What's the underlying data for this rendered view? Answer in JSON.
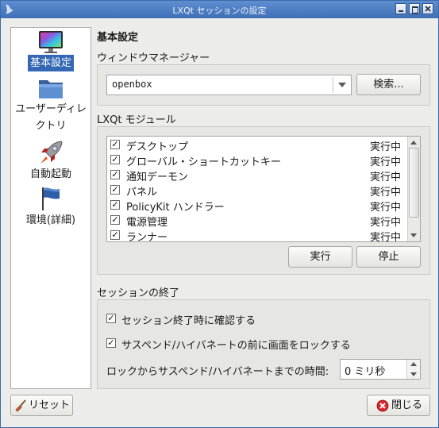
{
  "window": {
    "title": "LXQt セッションの設定"
  },
  "sidebar": {
    "items": [
      {
        "label": "基本設定",
        "icon": "monitor-icon",
        "selected": true
      },
      {
        "label": "ユーザーディレクトリ",
        "label_line1": "ユーザーディレ",
        "label_line2": "クトリ",
        "icon": "folder-icon",
        "selected": false
      },
      {
        "label": "自動起動",
        "icon": "rocket-icon",
        "selected": false
      },
      {
        "label": "環境(詳細)",
        "icon": "flag-icon",
        "selected": false
      }
    ]
  },
  "main": {
    "heading": "基本設定",
    "window_manager": {
      "label": "ウィンドウマネージャー",
      "value": "openbox",
      "search_button": "検索..."
    },
    "modules": {
      "label": "LXQt モジュール",
      "rows": [
        {
          "checked": true,
          "name": "デスクトップ",
          "status": "実行中"
        },
        {
          "checked": true,
          "name": "グローバル・ショートカットキー",
          "status": "実行中"
        },
        {
          "checked": true,
          "name": "通知デーモン",
          "status": "実行中"
        },
        {
          "checked": true,
          "name": "パネル",
          "status": "実行中"
        },
        {
          "checked": true,
          "name": "PolicyKit ハンドラー",
          "status": "実行中"
        },
        {
          "checked": true,
          "name": "電源管理",
          "status": "実行中"
        },
        {
          "checked": true,
          "name": "ランナー",
          "status": "実行中"
        }
      ],
      "start_button": "実行",
      "stop_button": "停止"
    },
    "session_end": {
      "label": "セッションの終了",
      "confirm_label": "セッション終了時に確認する",
      "confirm_checked": true,
      "lock_label": "サスペンド/ハイバネートの前に画面をロックする",
      "lock_checked": true,
      "delay_label": "ロックからサスペンド/ハイバネートまでの時間:",
      "delay_value": "0 ミリ秒"
    }
  },
  "footer": {
    "reset_button": "リセット",
    "close_button": "閉じる"
  },
  "colors": {
    "titlebar": "#4f80c5",
    "selection": "#3467b4",
    "close_icon": "#d9262b"
  }
}
